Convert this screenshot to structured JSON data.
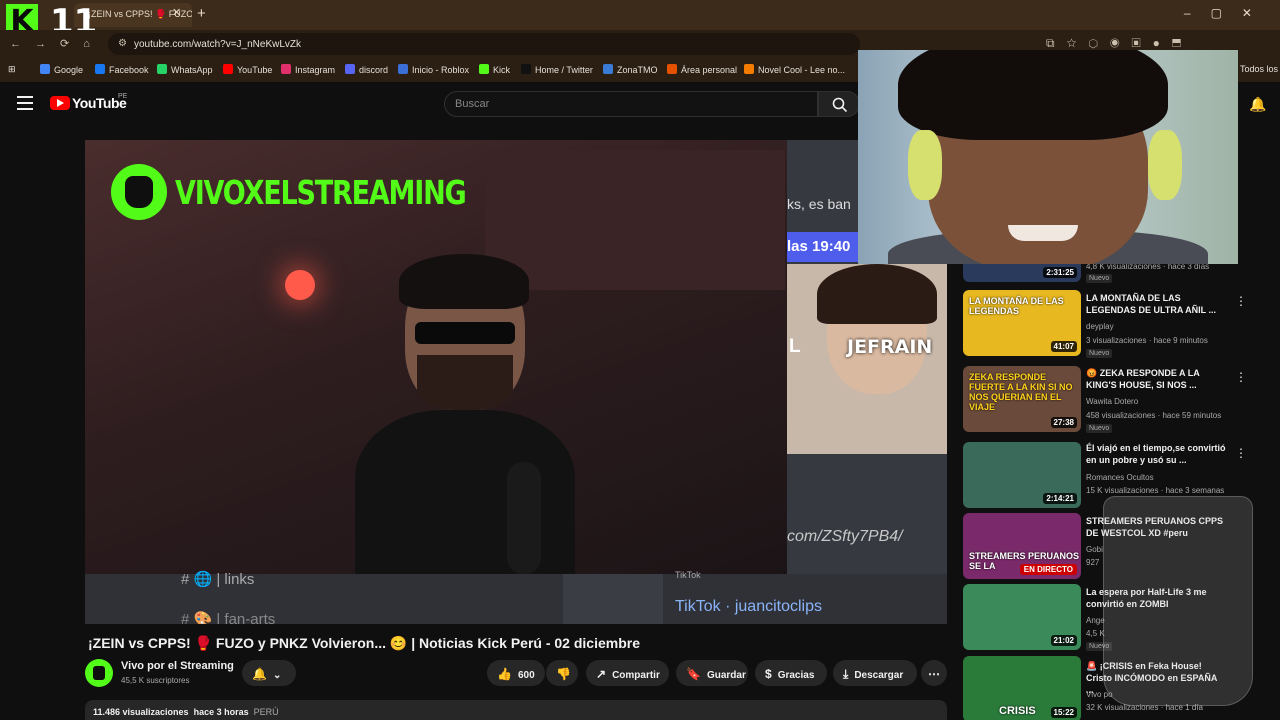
{
  "browser": {
    "tab_title": "¡ZEIN vs CPPS! 🥊 FUZO y PNKZ",
    "url": "youtube.com/watch?v=J_nNeKwLvZk",
    "logo_letter": "K",
    "logo_number": "11",
    "bookmarks": [
      {
        "label": "Google",
        "color": "#4285f4"
      },
      {
        "label": "Facebook",
        "color": "#1877f2"
      },
      {
        "label": "WhatsApp",
        "color": "#25d366"
      },
      {
        "label": "YouTube",
        "color": "#ff0000"
      },
      {
        "label": "Instagram",
        "color": "#e1306c"
      },
      {
        "label": "discord",
        "color": "#5865f2"
      },
      {
        "label": "Inicio - Roblox",
        "color": "#3a6fd8"
      },
      {
        "label": "Kick",
        "color": "#53fc18"
      },
      {
        "label": "Home / Twitter",
        "color": "#111111"
      },
      {
        "label": "ZonaTMO",
        "color": "#3a7bd5"
      },
      {
        "label": "Área personal",
        "color": "#e65100"
      },
      {
        "label": "Novel Cool - Lee no...",
        "color": "#f57c00"
      },
      {
        "label": "Todos los",
        "color": "#888888"
      }
    ]
  },
  "youtube": {
    "logo_text": "YouTube",
    "country": "PE",
    "search_placeholder": "Buscar"
  },
  "video": {
    "overlay_brand": "VIVOXELSTREAMING",
    "right_text_top": "ks, es ban",
    "time_chip": "las 19:40",
    "streamer_label": "JEFRAIN",
    "streamer_label_left": "L",
    "link_text": "com/ZSfty7PB4/",
    "channel_link": "# 🌐 | links",
    "channel_fanarts": "# 🎨 | fan-arts",
    "tiktok_label": "TikTok",
    "tiktok_link": "TikTok · juancitoclips",
    "title": "¡ZEIN vs CPPS! 🥊 FUZO y PNKZ Volvieron... 😊 | Noticias Kick Perú - 02 diciembre",
    "channel_name": "Vivo por el Streaming",
    "subscribers": "45,5 K suscriptores",
    "likes": "600",
    "share_label": "Compartir",
    "save_label": "Guardar",
    "thanks_label": "Gracias",
    "download_label": "Descargar",
    "views": "11.486 visualizaciones",
    "age": "hace 3 horas",
    "location": "PERÚ"
  },
  "sidebar": {
    "items": [
      {
        "thumb_text": "",
        "duration": "2:31:25",
        "title": "",
        "channel": "",
        "meta": "4,8 K visualizaciones · hace 3 días",
        "badge": "Nuevo",
        "color": "#2a3a5c"
      },
      {
        "thumb_text": "LA MONTAÑA DE LAS LEGENDAS",
        "duration": "41:07",
        "title": "LA MONTAÑA DE LAS LEGENDAS DE ULTRA AÑIL ...",
        "channel": "deyplay",
        "meta": "3 visualizaciones · hace 9 minutos",
        "badge": "Nuevo",
        "color": "#e8b820"
      },
      {
        "thumb_text": "ZEKA RESPONDE FUERTE A LA KIN SI NO NOS QUERIAN EN EL VIAJE",
        "duration": "27:38",
        "title": "😡 ZEKA RESPONDE A LA KING'S HOUSE, SI NOS ...",
        "channel": "Wawita Dotero",
        "meta": "458 visualizaciones · hace 59 minutos",
        "badge": "Nuevo",
        "color": "#6a4a3a"
      },
      {
        "thumb_text": "",
        "duration": "2:14:21",
        "title": "Él viajó en el tiempo,se convirtió en un pobre y usó su ...",
        "channel": "Romances Ocultos",
        "meta": "15 K visualizaciones · hace 3 semanas",
        "badge": "",
        "color": "#3a6a5a"
      },
      {
        "thumb_text": "STREAMERS PERUANOS SE LA",
        "duration": "EN DIRECTO",
        "title": "STREAMERS PERUANOS CPPS DE WESTCOL XD #peru",
        "channel": "Gobi",
        "meta": "927",
        "badge": "",
        "color": "#7a2a6a"
      },
      {
        "thumb_text": "",
        "duration": "21:02",
        "title": "La espera por Half-Life 3 me convirtió en ZOMBI",
        "channel": "Ange",
        "meta": "4,5 K",
        "badge": "Nuevo",
        "color": "#3a8a5a"
      },
      {
        "thumb_text": "CRISIS",
        "duration": "15:22",
        "title": "🚨 ¡CRISIS en Feka House! Cristo INCÓMODO en ESPAÑA ...",
        "channel": "Vivo po",
        "meta": "32 K visualizaciones · hace 1 día",
        "badge": "",
        "color": "#2a7a3a"
      }
    ]
  }
}
